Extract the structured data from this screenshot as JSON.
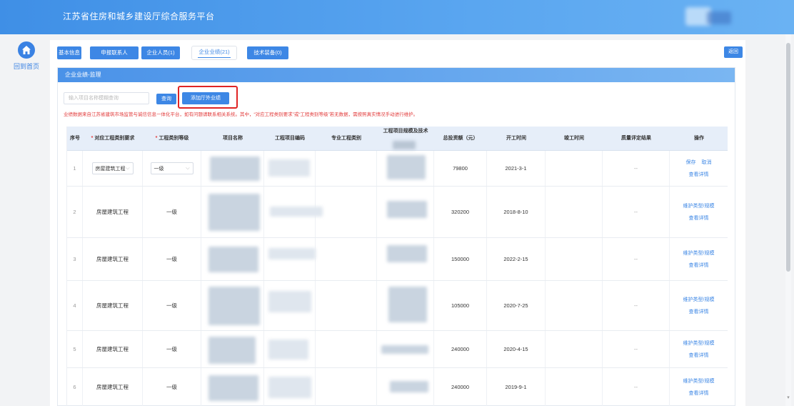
{
  "header": {
    "title": "江苏省住房和城乡建设厅综合服务平台"
  },
  "sidebar": {
    "home_label": "回到首页",
    "home_icon": "home-icon"
  },
  "tabs": [
    {
      "label": "基本信息",
      "active": false
    },
    {
      "label": "申报联系人",
      "active": false
    },
    {
      "label": "企业人员(1)",
      "active": false
    },
    {
      "label": "企业业绩(21)",
      "active": true
    },
    {
      "label": "技术装备(0)",
      "active": false
    }
  ],
  "back_button": "返回",
  "section": {
    "title": "企业业绩-监理",
    "search_placeholder": "输入项目名称模糊查询",
    "query_button": "查询",
    "add_button": "添加厅外业绩",
    "notice": "业绩数据来自江苏省建筑市场监管与诚信信息一体化平台，如有问题请联系相关系统。其中，“对应工程类别要求”或“工程类别等级”若无数据，需按照真实情况手动进行维护。"
  },
  "table": {
    "headers": [
      {
        "label": "序号",
        "required": false
      },
      {
        "label": "对应工程类别要求",
        "required": true
      },
      {
        "label": "工程类别等级",
        "required": true
      },
      {
        "label": "项目名称",
        "required": false
      },
      {
        "label": "工程项目编码",
        "required": false
      },
      {
        "label": "专业工程类别",
        "required": false
      },
      {
        "label": "工程项目规模及技术",
        "required": false
      },
      {
        "label": "总投资额（元）",
        "required": false
      },
      {
        "label": "开工时间",
        "required": false
      },
      {
        "label": "竣工时间",
        "required": false
      },
      {
        "label": "质量评定结果",
        "required": false
      },
      {
        "label": "操作",
        "required": false
      }
    ],
    "rows": [
      {
        "no": "1",
        "category": "房屋建筑工程",
        "level": "一级",
        "investment": "79800",
        "start": "2021-3-1",
        "quality": "--",
        "editing": true,
        "op1": "保存",
        "op1b": "取消",
        "op2": "查看详情"
      },
      {
        "no": "2",
        "category": "房屋建筑工程",
        "level": "一级",
        "investment": "320200",
        "start": "2018-8-10",
        "quality": "--",
        "editing": false,
        "op1": "维护类型/规模",
        "op2": "查看详情"
      },
      {
        "no": "3",
        "category": "房屋建筑工程",
        "level": "一级",
        "investment": "150000",
        "start": "2022-2-15",
        "quality": "--",
        "editing": false,
        "op1": "维护类型/规模",
        "op2": "查看详情"
      },
      {
        "no": "4",
        "category": "房屋建筑工程",
        "level": "一级",
        "investment": "105000",
        "start": "2020-7-25",
        "quality": "--",
        "editing": false,
        "op1": "维护类型/规模",
        "op2": "查看详情"
      },
      {
        "no": "5",
        "category": "房屋建筑工程",
        "level": "一级",
        "investment": "240000",
        "start": "2020-4-15",
        "quality": "--",
        "editing": false,
        "op1": "维护类型/规模",
        "op2": "查看详情"
      },
      {
        "no": "6",
        "category": "房屋建筑工程",
        "level": "一级",
        "investment": "240000",
        "start": "2019-9-1",
        "quality": "--",
        "editing": false,
        "op1": "维护类型/规模",
        "op2": "查看详情"
      }
    ]
  }
}
